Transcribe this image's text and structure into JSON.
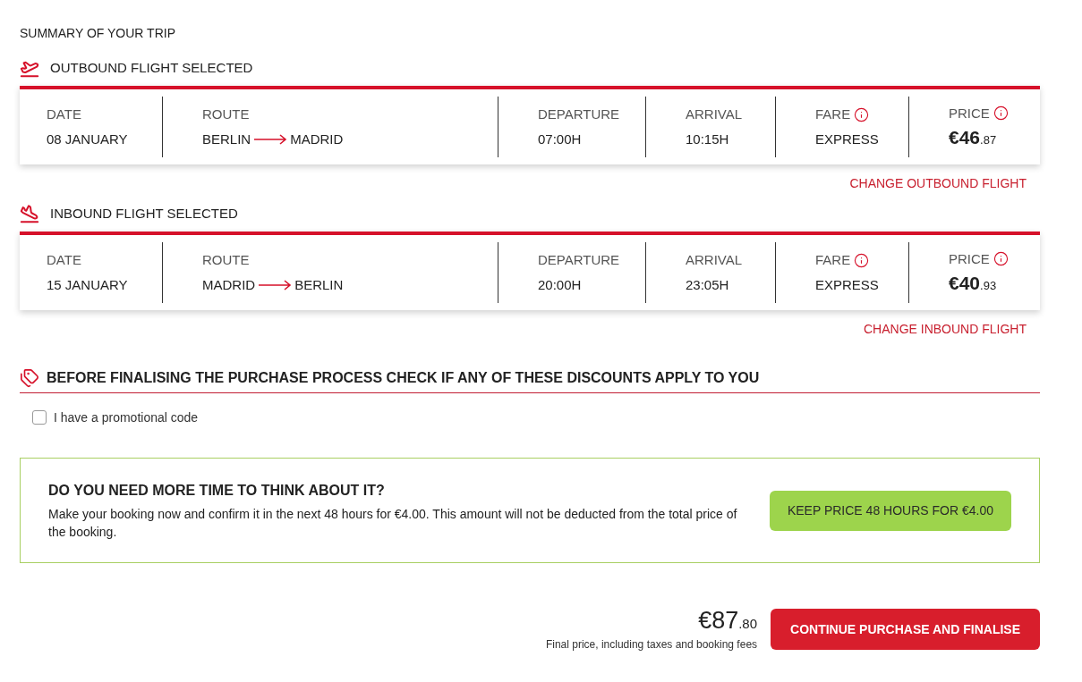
{
  "summary_title": "SUMMARY OF YOUR TRIP",
  "flights": [
    {
      "kind": "outbound",
      "title": "OUTBOUND FLIGHT SELECTED",
      "date_label": "DATE",
      "date": "08 JANUARY",
      "route_label": "ROUTE",
      "origin": "BERLIN",
      "destination": "MADRID",
      "departure_label": "DEPARTURE",
      "departure": "07:00H",
      "arrival_label": "ARRIVAL",
      "arrival": "10:15H",
      "fare_label": "FARE",
      "fare": "EXPRESS",
      "price_label": "PRICE",
      "price_main": "€46",
      "price_decimals": ".87",
      "change_link": "CHANGE OUTBOUND FLIGHT"
    },
    {
      "kind": "inbound",
      "title": "INBOUND FLIGHT SELECTED",
      "date_label": "DATE",
      "date": "15 JANUARY",
      "route_label": "ROUTE",
      "origin": "MADRID",
      "destination": "BERLIN",
      "departure_label": "DEPARTURE",
      "departure": "20:00H",
      "arrival_label": "ARRIVAL",
      "arrival": "23:05H",
      "fare_label": "FARE",
      "fare": "EXPRESS",
      "price_label": "PRICE",
      "price_main": "€40",
      "price_decimals": ".93",
      "change_link": "CHANGE INBOUND FLIGHT"
    }
  ],
  "discounts": {
    "title": "BEFORE FINALISING THE PURCHASE PROCESS CHECK IF ANY OF THESE DISCOUNTS APPLY TO YOU",
    "promo_checkbox": {
      "label": "I have a promotional code",
      "checked": false
    }
  },
  "hold_offer": {
    "title": "DO YOU NEED MORE TIME TO THINK ABOUT IT?",
    "text": "Make your booking now and confirm it in the next 48 hours for €4.00. This amount will not be deducted from the total price of the booking.",
    "button": "KEEP PRICE 48 HOURS FOR €4.00"
  },
  "total": {
    "price_main": "€87",
    "price_decimals": ".80",
    "note": "Final price, including taxes and booking fees",
    "button": "CONTINUE PURCHASE AND FINALISE"
  }
}
